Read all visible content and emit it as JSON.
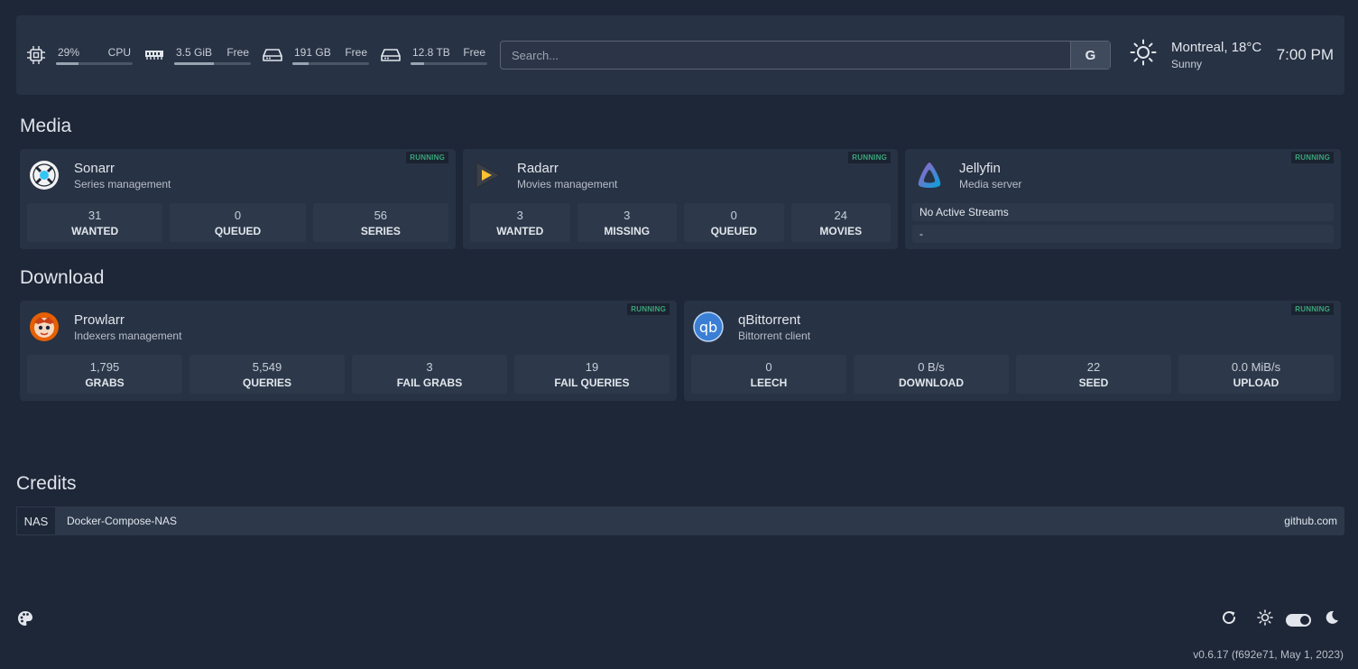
{
  "resources": [
    {
      "icon": "cpu-icon",
      "value": "29%",
      "label": "CPU",
      "usage": 0.29
    },
    {
      "icon": "memory-icon",
      "value": "3.5 GiB",
      "label": "Free",
      "usage": 0.52
    },
    {
      "icon": "disk-icon",
      "value": "191 GB",
      "label": "Free",
      "usage": 0.21
    },
    {
      "icon": "disk-icon",
      "value": "12.8 TB",
      "label": "Free",
      "usage": 0.18
    }
  ],
  "search": {
    "placeholder": "Search...",
    "provider": "G"
  },
  "weather": {
    "icon": "sun-icon",
    "location": "Montreal, 18°C",
    "condition": "Sunny"
  },
  "clock": "7:00 PM",
  "media": {
    "title": "Media",
    "sonarr": {
      "name": "Sonarr",
      "desc": "Series management",
      "status": "RUNNING",
      "stats": [
        {
          "value": "31",
          "label": "WANTED"
        },
        {
          "value": "0",
          "label": "QUEUED"
        },
        {
          "value": "56",
          "label": "SERIES"
        }
      ]
    },
    "radarr": {
      "name": "Radarr",
      "desc": "Movies management",
      "status": "RUNNING",
      "stats": [
        {
          "value": "3",
          "label": "WANTED"
        },
        {
          "value": "3",
          "label": "MISSING"
        },
        {
          "value": "0",
          "label": "QUEUED"
        },
        {
          "value": "24",
          "label": "MOVIES"
        }
      ]
    },
    "jellyfin": {
      "name": "Jellyfin",
      "desc": "Media server",
      "status": "RUNNING",
      "streams": "No Active Streams",
      "stream_detail": "-"
    }
  },
  "download": {
    "title": "Download",
    "prowlarr": {
      "name": "Prowlarr",
      "desc": "Indexers management",
      "status": "RUNNING",
      "stats": [
        {
          "value": "1,795",
          "label": "GRABS"
        },
        {
          "value": "5,549",
          "label": "QUERIES"
        },
        {
          "value": "3",
          "label": "FAIL GRABS"
        },
        {
          "value": "19",
          "label": "FAIL QUERIES"
        }
      ]
    },
    "qbittorrent": {
      "name": "qBittorrent",
      "desc": "Bittorrent client",
      "status": "RUNNING",
      "stats": [
        {
          "value": "0",
          "label": "LEECH"
        },
        {
          "value": "0 B/s",
          "label": "DOWNLOAD"
        },
        {
          "value": "22",
          "label": "SEED"
        },
        {
          "value": "0.0 MiB/s",
          "label": "UPLOAD"
        }
      ]
    }
  },
  "credits": {
    "title": "Credits",
    "tag": "NAS",
    "link": "Docker-Compose-NAS",
    "site": "github.com"
  },
  "version": "v0.6.17 (f692e71, May 1, 2023)"
}
